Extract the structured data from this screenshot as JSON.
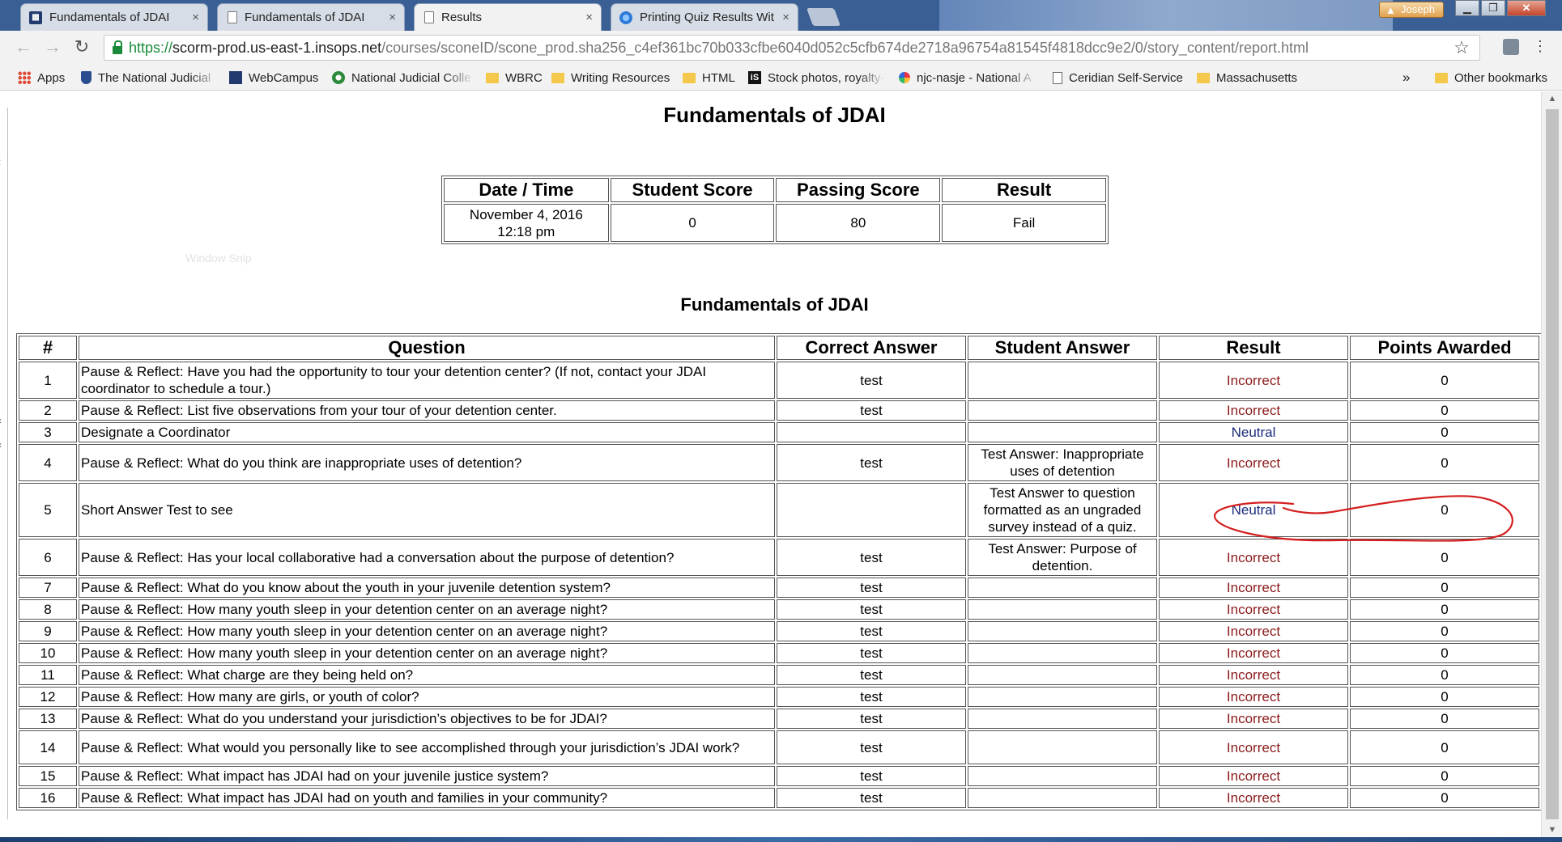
{
  "browser": {
    "tabs": [
      {
        "label": "Fundamentals of JDAI",
        "icon": "book-icon"
      },
      {
        "label": "Fundamentals of JDAI",
        "icon": "page-icon"
      },
      {
        "label": "Results",
        "icon": "page-icon"
      },
      {
        "label": "Printing Quiz Results Wit",
        "icon": "globe-icon"
      }
    ],
    "close_glyph": "×",
    "profile_name": "Joseph",
    "url": {
      "scheme": "https://",
      "host": "scorm-prod.us-east-1.insops.net",
      "path": "/courses/sconeID/scone_prod.sha256_c4ef361bc70b033cfbe6040d052c5cfb674de2718a96754a81545f4818dcc9e2/0/story_content/report.html"
    },
    "bookmarks": [
      {
        "label": "Apps",
        "icon": "apps-icon"
      },
      {
        "label": "The National Judicial",
        "icon": "shield-icon"
      },
      {
        "label": "WebCampus",
        "icon": "webcampus-icon"
      },
      {
        "label": "National Judicial Colle",
        "icon": "njc-icon"
      },
      {
        "label": "WBRC",
        "icon": "folder-icon"
      },
      {
        "label": "Writing Resources",
        "icon": "folder-icon"
      },
      {
        "label": "HTML",
        "icon": "folder-icon"
      },
      {
        "label": "Stock photos, royalty-",
        "icon": "istock-icon"
      },
      {
        "label": "njc-nasje - National A",
        "icon": "pinwheel-icon"
      },
      {
        "label": "Ceridian Self-Service",
        "icon": "doc-icon"
      },
      {
        "label": "Massachusetts",
        "icon": "folder-icon"
      }
    ],
    "overflow_glyph": "»",
    "other_bookmarks": "Other bookmarks"
  },
  "report": {
    "title": "Fundamentals of JDAI",
    "summary": {
      "headers": [
        "Date / Time",
        "Student Score",
        "Passing Score",
        "Result"
      ],
      "date": "November 4, 2016",
      "time": "12:18 pm",
      "student_score": "0",
      "passing_score": "80",
      "result": "Fail"
    },
    "ghost_text": "Window Snip",
    "section_title": "Fundamentals of JDAI",
    "table": {
      "headers": [
        "#",
        "Question",
        "Correct Answer",
        "Student Answer",
        "Result",
        "Points Awarded"
      ],
      "rows": [
        {
          "num": "1",
          "question": "Pause & Reflect: Have you had the opportunity to tour your detention center? (If not, contact your JDAI coordinator to schedule a tour.)",
          "correct": "test",
          "student": "",
          "result": "Incorrect",
          "points": "0"
        },
        {
          "num": "2",
          "question": "Pause & Reflect: List five observations from your tour of your detention center.",
          "correct": "test",
          "student": "",
          "result": "Incorrect",
          "points": "0"
        },
        {
          "num": "3",
          "question": "Designate a Coordinator",
          "correct": "",
          "student": "",
          "result": "Neutral",
          "points": "0"
        },
        {
          "num": "4",
          "question": "Pause & Reflect: What do you think are inappropriate uses of detention?",
          "correct": "test",
          "student": "Test Answer: Inappropriate uses of detention",
          "result": "Incorrect",
          "points": "0"
        },
        {
          "num": "5",
          "question": "Short Answer Test to see",
          "correct": "",
          "student": "Test Answer to question formatted as an ungraded survey instead of a quiz.",
          "result": "Neutral",
          "points": "0"
        },
        {
          "num": "6",
          "question": "Pause & Reflect: Has your local collaborative had a conversation about the purpose of detention?",
          "correct": "test",
          "student": "Test Answer: Purpose of detention.",
          "result": "Incorrect",
          "points": "0"
        },
        {
          "num": "7",
          "question": "Pause & Reflect: What do you know about the youth in your juvenile detention system?",
          "correct": "test",
          "student": "",
          "result": "Incorrect",
          "points": "0"
        },
        {
          "num": "8",
          "question": "Pause & Reflect: How many youth sleep in your detention center on an average night?",
          "correct": "test",
          "student": "",
          "result": "Incorrect",
          "points": "0"
        },
        {
          "num": "9",
          "question": "Pause & Reflect: How many youth sleep in your detention center on an average night?",
          "correct": "test",
          "student": "",
          "result": "Incorrect",
          "points": "0"
        },
        {
          "num": "10",
          "question": "Pause & Reflect: How many youth sleep in your detention center on an average night?",
          "correct": "test",
          "student": "",
          "result": "Incorrect",
          "points": "0"
        },
        {
          "num": "11",
          "question": "Pause & Reflect: What charge are they being held on?",
          "correct": "test",
          "student": "",
          "result": "Incorrect",
          "points": "0"
        },
        {
          "num": "12",
          "question": "Pause & Reflect: How many are girls, or youth of color?",
          "correct": "test",
          "student": "",
          "result": "Incorrect",
          "points": "0"
        },
        {
          "num": "13",
          "question": "Pause & Reflect: What do you understand your jurisdiction’s objectives to be for JDAI?",
          "correct": "test",
          "student": "",
          "result": "Incorrect",
          "points": "0"
        },
        {
          "num": "14",
          "question": "Pause & Reflect: What would you personally like to see accomplished through your jurisdiction’s JDAI work?",
          "correct": "test",
          "student": "",
          "result": "Incorrect",
          "points": "0"
        },
        {
          "num": "15",
          "question": "Pause & Reflect: What impact has JDAI had on your juvenile justice system?",
          "correct": "test",
          "student": "",
          "result": "Incorrect",
          "points": "0"
        },
        {
          "num": "16",
          "question": "Pause & Reflect: What impact has JDAI had on youth and families in your community?",
          "correct": "test",
          "student": "",
          "result": "Incorrect",
          "points": "0"
        }
      ]
    }
  },
  "colors": {
    "incorrect": "#8b1a1a",
    "neutral": "#1a2a7a",
    "annotation": "#d42020",
    "secure": "#1a8a3a"
  }
}
